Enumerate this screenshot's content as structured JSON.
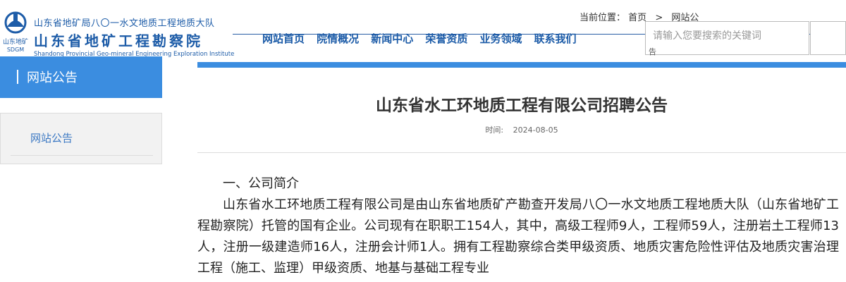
{
  "logo": {
    "mark_text": "山东地矿",
    "mark_abbr": "SDGM",
    "line1": "山东省地矿局八〇一水文地质工程地质大队",
    "line2": "山东省地矿工程勘察院",
    "line3": "Shandong Provincial Geo-mineral Engineering Exploration Institute",
    "color": "#1d5ca8"
  },
  "breadcrumb": {
    "prefix": "当前位置：",
    "home": "首页",
    "separator": ">",
    "current": "网站公"
  },
  "nav": {
    "items": [
      "网站首页",
      "院情概况",
      "新闻中心",
      "荣誉资质",
      "业务领域",
      "联系我们"
    ]
  },
  "search": {
    "placeholder": "请输入您要搜索的关键词",
    "overflow_char": "告"
  },
  "sidebar": {
    "title": "网站公告",
    "items": [
      "网站公告"
    ]
  },
  "article": {
    "title": "山东省水工环地质工程有限公司招聘公告",
    "date_label": "时间:",
    "date": "2024-08-05",
    "section_heading": "一、公司简介",
    "paragraph": "山东省水工环地质工程有限公司是由山东省地质矿产勘查开发局八〇一水文地质工程地质大队（山东省地矿工程勘察院）托管的国有企业。公司现有在职职工154人，其中，高级工程师9人，工程师59人，注册岩土工程师13人，注册一级建造师16人，注册会计师1人。拥有工程勘察综合类甲级资质、地质灾害危险性评估及地质灾害治理工程（施工、监理）甲级资质、地基与基础工程专业"
  },
  "colors": {
    "accent": "#3b8de0",
    "nav_text": "#1d5ca8"
  }
}
